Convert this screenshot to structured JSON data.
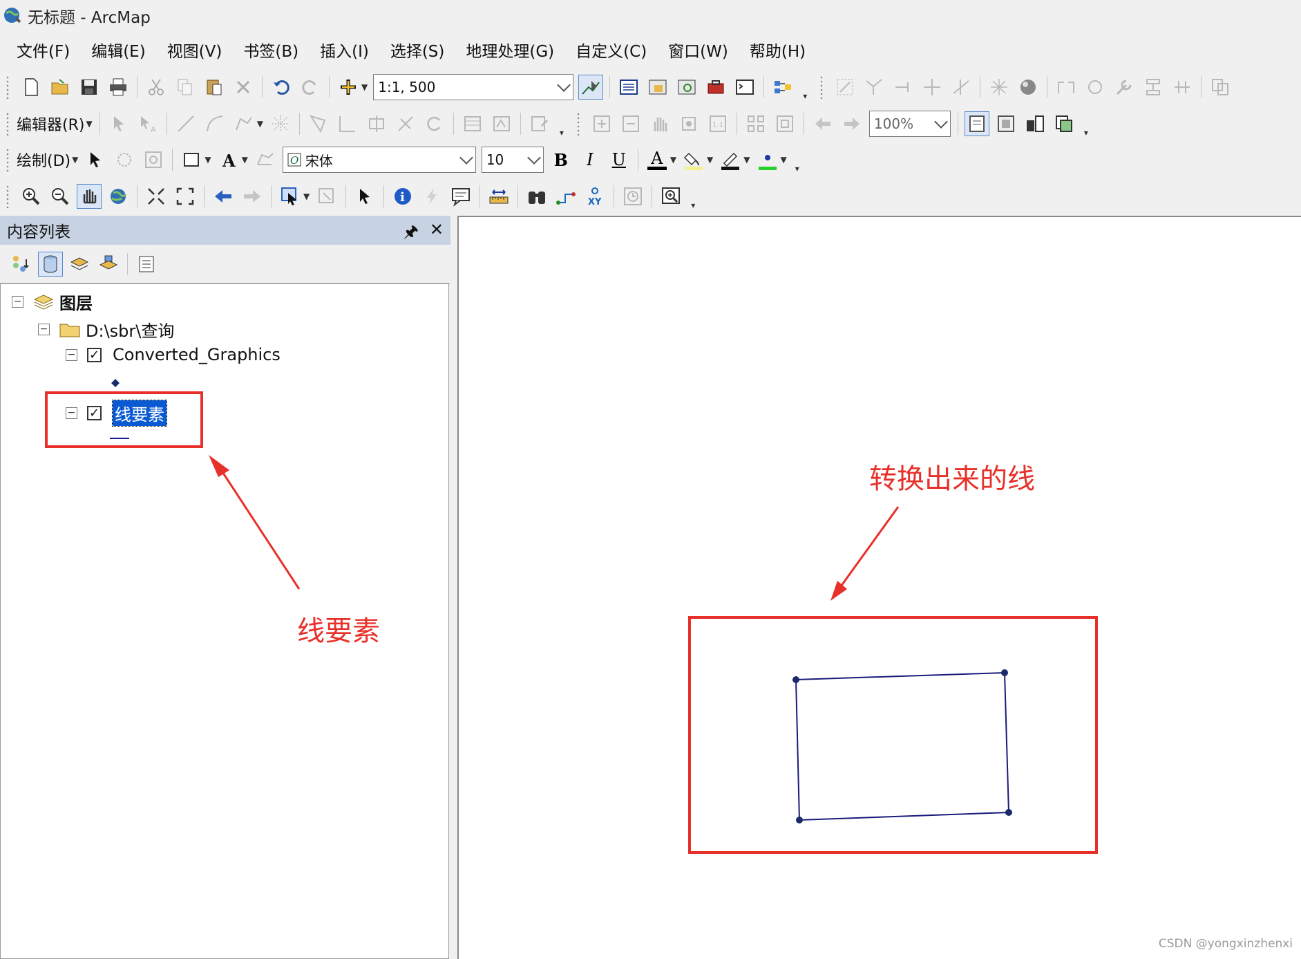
{
  "window": {
    "title": "无标题 - ArcMap"
  },
  "menu": [
    "文件(F)",
    "编辑(E)",
    "视图(V)",
    "书签(B)",
    "插入(I)",
    "选择(S)",
    "地理处理(G)",
    "自定义(C)",
    "窗口(W)",
    "帮助(H)"
  ],
  "toolbar": {
    "scale_value": "1:1, 500",
    "editor_label": "编辑器(R)",
    "zoom_value": "100%",
    "draw_label": "绘制(D)",
    "font_name": "宋体",
    "font_size": "10",
    "bold_label": "B",
    "italic_label": "I",
    "underline_label": "U",
    "font_color_label": "A"
  },
  "toc": {
    "header": "内容列表",
    "root": "图层",
    "folder": "D:\\sbr\\查询",
    "layer1": "Converted_Graphics",
    "layer2": "线要素"
  },
  "annotations": {
    "left": "线要素",
    "right": "转换出来的线"
  },
  "colors": {
    "annotation": "#e8302a",
    "polygon_line": "#1a1a7a",
    "selection": "#0a5bd3"
  },
  "watermark": "CSDN @yongxinzhenxi"
}
